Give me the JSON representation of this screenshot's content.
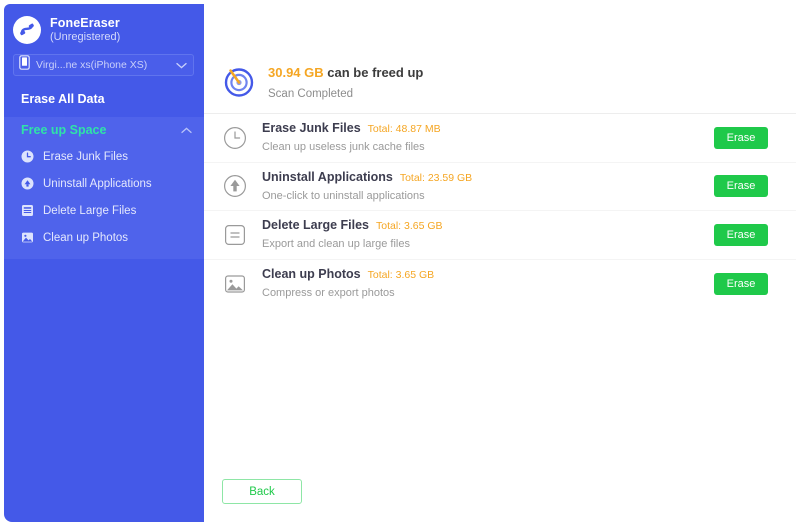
{
  "brand": {
    "name": "FoneEraser",
    "status": "(Unregistered)",
    "logo_icon": "eraser-logo-icon"
  },
  "device": {
    "icon": "phone-icon",
    "selected": "Virgi...ne xs(iPhone XS)",
    "chevron_icon": "chevron-down-icon"
  },
  "sidebar": {
    "erase_all_data": "Erase All Data",
    "group": {
      "title": "Free up Space",
      "collapse_icon": "chevron-up-icon",
      "items": [
        {
          "label": "Erase Junk Files",
          "icon": "clock-icon"
        },
        {
          "label": "Uninstall Applications",
          "icon": "arrow-up-circle-icon"
        },
        {
          "label": "Delete Large Files",
          "icon": "file-lines-icon"
        },
        {
          "label": "Clean up Photos",
          "icon": "photo-icon"
        }
      ]
    }
  },
  "titlebar": {
    "buttons": [
      {
        "name": "cart-icon",
        "title": "Cart"
      },
      {
        "name": "key-icon",
        "title": "Register"
      },
      {
        "name": "menu-icon",
        "title": "Menu"
      },
      {
        "name": "chat-icon",
        "title": "Feedback"
      },
      {
        "name": "minimize-icon",
        "title": "Minimize"
      },
      {
        "name": "close-icon",
        "title": "Close"
      }
    ]
  },
  "summary": {
    "icon": "scan-target-icon",
    "amount": "30.94 GB",
    "title_rest": " can be freed up",
    "status": "Scan Completed"
  },
  "rows": [
    {
      "icon": "clock-icon",
      "title": "Erase Junk Files",
      "total": "Total: 48.87 MB",
      "desc": "Clean up useless junk cache files",
      "action": "Erase"
    },
    {
      "icon": "arrow-up-circle-icon",
      "title": "Uninstall Applications",
      "total": "Total: 23.59 GB",
      "desc": "One-click to uninstall applications",
      "action": "Erase"
    },
    {
      "icon": "file-equals-icon",
      "title": "Delete Large Files",
      "total": "Total: 3.65 GB",
      "desc": "Export and clean up large files",
      "action": "Erase"
    },
    {
      "icon": "photo-icon",
      "title": "Clean up Photos",
      "total": "Total: 3.65 GB",
      "desc": "Compress or export photos",
      "action": "Erase"
    }
  ],
  "footer": {
    "back": "Back"
  },
  "colors": {
    "sidebar_bg": "#4459e8",
    "sidebar_group_bg": "#4f63eb",
    "accent_green": "#2fe3a8",
    "button_green": "#1fc94a",
    "amount_orange": "#f5a623"
  }
}
